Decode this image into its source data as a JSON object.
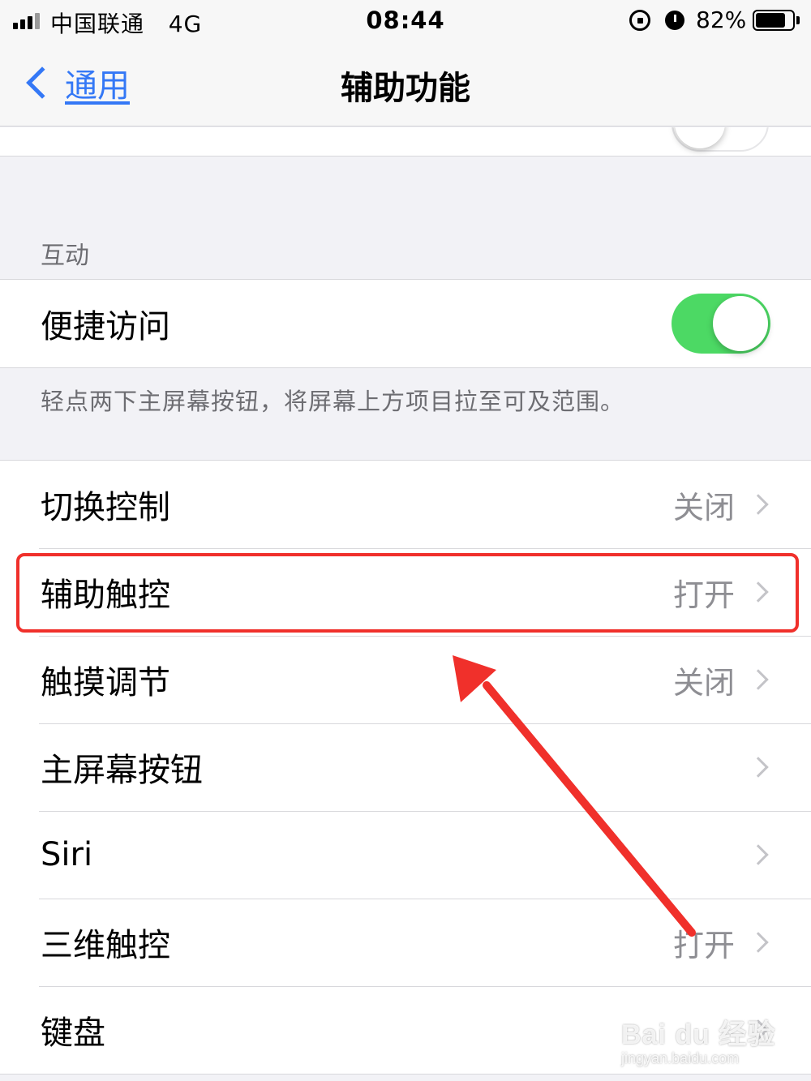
{
  "status_bar": {
    "carrier": "中国联通",
    "network": "4G",
    "time": "08:44",
    "battery_percent": "82%",
    "battery_level": 0.82,
    "icons": [
      "signal-icon",
      "rotation-lock-icon",
      "alarm-icon",
      "battery-icon"
    ]
  },
  "nav": {
    "back_label": "通用",
    "title": "辅助功能"
  },
  "interaction_section": {
    "header": "互动",
    "reachability": {
      "label": "便捷访问",
      "enabled": true
    },
    "reachability_note": "轻点两下主屏幕按钮，将屏幕上方项目拉至可及范围。"
  },
  "rows": [
    {
      "label": "切换控制",
      "value": "关闭"
    },
    {
      "label": "辅助触控",
      "value": "打开"
    },
    {
      "label": "触摸调节",
      "value": "关闭"
    },
    {
      "label": "主屏幕按钮",
      "value": ""
    },
    {
      "label": "Siri",
      "value": ""
    },
    {
      "label": "三维触控",
      "value": "打开"
    },
    {
      "label": "键盘",
      "value": ""
    }
  ],
  "colors": {
    "accent": "#3478f6",
    "toggle_on": "#4cd964",
    "annotation_red": "#f0302b"
  },
  "watermark": {
    "main": "Bai du 经验",
    "sub": "jingyan.baidu.com"
  }
}
